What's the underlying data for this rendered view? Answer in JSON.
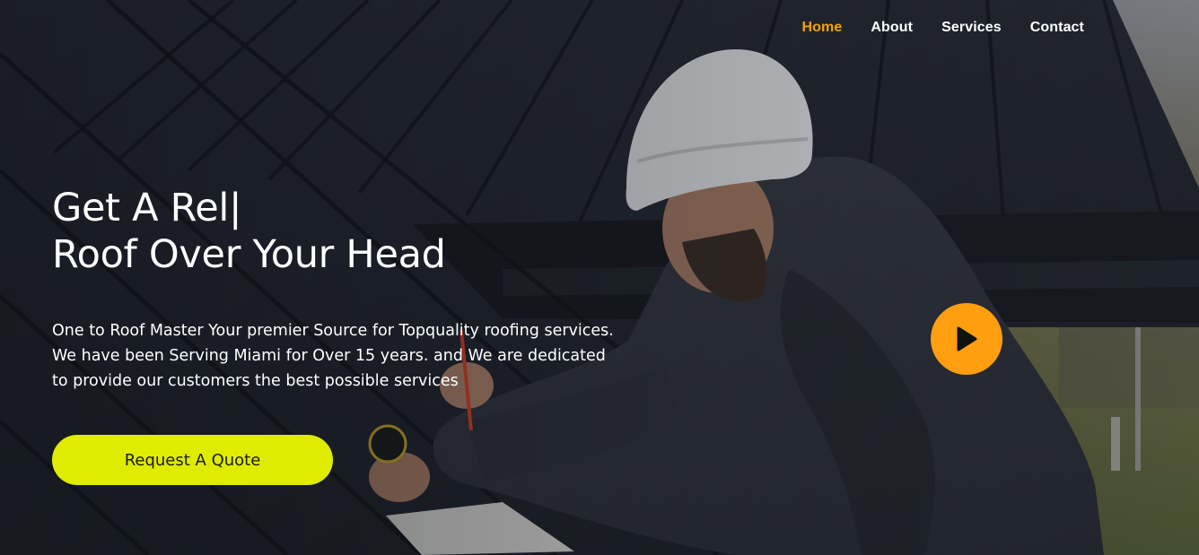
{
  "nav": {
    "items": [
      {
        "label": "Home",
        "active": true
      },
      {
        "label": "About",
        "active": false
      },
      {
        "label": "Services",
        "active": false
      },
      {
        "label": "Contact",
        "active": false
      }
    ],
    "active_color": "#f5a300"
  },
  "hero": {
    "title_line1": "Get A Rel|",
    "title_line2": "Roof Over Your Head",
    "description": "One to Roof Master Your premier Source for Topquality roofing services. We have been Serving Miami for Over 15 years. and We are dedicated to provide our customers the best possible services",
    "cta_label": "Request A Quote",
    "cta_color": "#dfec00",
    "play_icon": "play-icon",
    "play_color": "#ff9e0f"
  }
}
